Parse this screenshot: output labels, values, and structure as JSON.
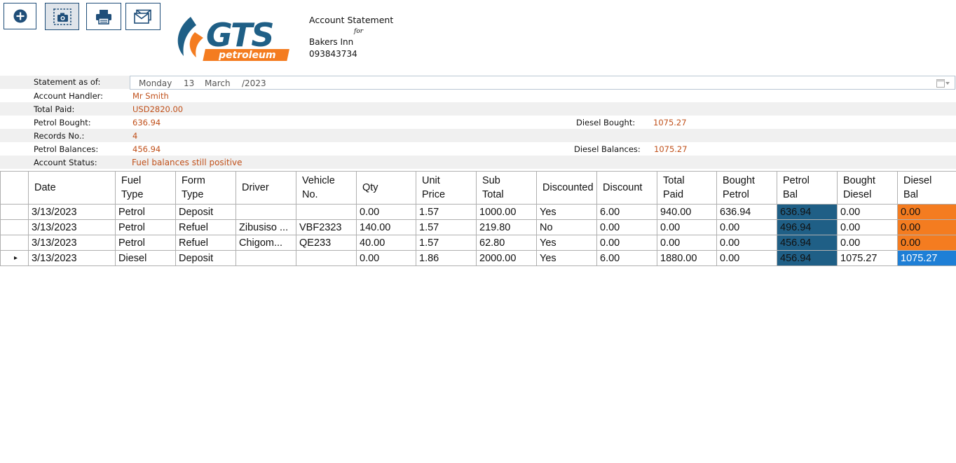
{
  "toolbar": {
    "buttons": [
      {
        "name": "add-button",
        "icon": "plus-circle-icon"
      },
      {
        "name": "screenshot-button",
        "icon": "camera-icon"
      },
      {
        "name": "print-button",
        "icon": "printer-icon"
      },
      {
        "name": "email-button",
        "icon": "mail-icon"
      }
    ]
  },
  "logo": {
    "main": "GTS",
    "sub": "petroleum",
    "colors": {
      "blue": "#1f5f86",
      "orange": "#f47c20"
    }
  },
  "header": {
    "title": "Account Statement",
    "for": "for",
    "customer": "Bakers Inn",
    "phone": "093843734"
  },
  "statement": {
    "as_of_label": "Statement as of:",
    "date": {
      "weekday": "Monday",
      "day": "13",
      "month": "March",
      "year": "/2023"
    },
    "handler_label": "Account Handler:",
    "handler": "Mr Smith",
    "total_paid_label": "Total Paid:",
    "total_paid": "USD2820.00",
    "petrol_bought_label": "Petrol Bought:",
    "petrol_bought": "636.94",
    "diesel_bought_label": "Diesel Bought:",
    "diesel_bought": "1075.27",
    "records_label": "Records No.:",
    "records": "4",
    "petrol_bal_label": "Petrol Balances:",
    "petrol_bal": "456.94",
    "diesel_bal_label": "Diesel Balances:",
    "diesel_bal": "1075.27",
    "status_label": "Account Status:",
    "status": "Fuel balances still positive"
  },
  "grid": {
    "columns": [
      [
        "Date"
      ],
      [
        "Fuel",
        "Type"
      ],
      [
        "Form",
        "Type"
      ],
      [
        "Driver"
      ],
      [
        "Vehicle",
        "No."
      ],
      [
        "Qty"
      ],
      [
        "Unit",
        "Price"
      ],
      [
        "Sub",
        "Total"
      ],
      [
        "Discounted"
      ],
      [
        "Discount"
      ],
      [
        "Total",
        "Paid"
      ],
      [
        "Bought",
        "Petrol"
      ],
      [
        "Petrol",
        "Bal"
      ],
      [
        "Bought",
        "Diesel"
      ],
      [
        "Diesel",
        "Bal"
      ]
    ],
    "current_row_marker": "▸",
    "rows": [
      [
        "3/13/2023",
        "Petrol",
        "Deposit",
        "",
        "",
        "0.00",
        "1.57",
        "1000.00",
        "Yes",
        "6.00",
        "940.00",
        "636.94",
        "636.94",
        "0.00",
        "0.00"
      ],
      [
        "3/13/2023",
        "Petrol",
        "Refuel",
        "Zibusiso ...",
        "VBF2323",
        "140.00",
        "1.57",
        "219.80",
        "No",
        "0.00",
        "0.00",
        "0.00",
        "496.94",
        "0.00",
        "0.00"
      ],
      [
        "3/13/2023",
        "Petrol",
        "Refuel",
        "Chigom...",
        "QE233",
        "40.00",
        "1.57",
        "62.80",
        "Yes",
        "0.00",
        "0.00",
        "0.00",
        "456.94",
        "0.00",
        "0.00"
      ],
      [
        "3/13/2023",
        "Diesel",
        "Deposit",
        "",
        "",
        "0.00",
        "1.86",
        "2000.00",
        "Yes",
        "6.00",
        "1880.00",
        "0.00",
        "456.94",
        "1075.27",
        "1075.27"
      ]
    ],
    "current_row": 3,
    "colors": {
      "qty": "#3cb43c",
      "petrol_bal": "#1f5f86",
      "diesel_bal": "#f47c20",
      "selected": "#1e7fd6"
    }
  }
}
